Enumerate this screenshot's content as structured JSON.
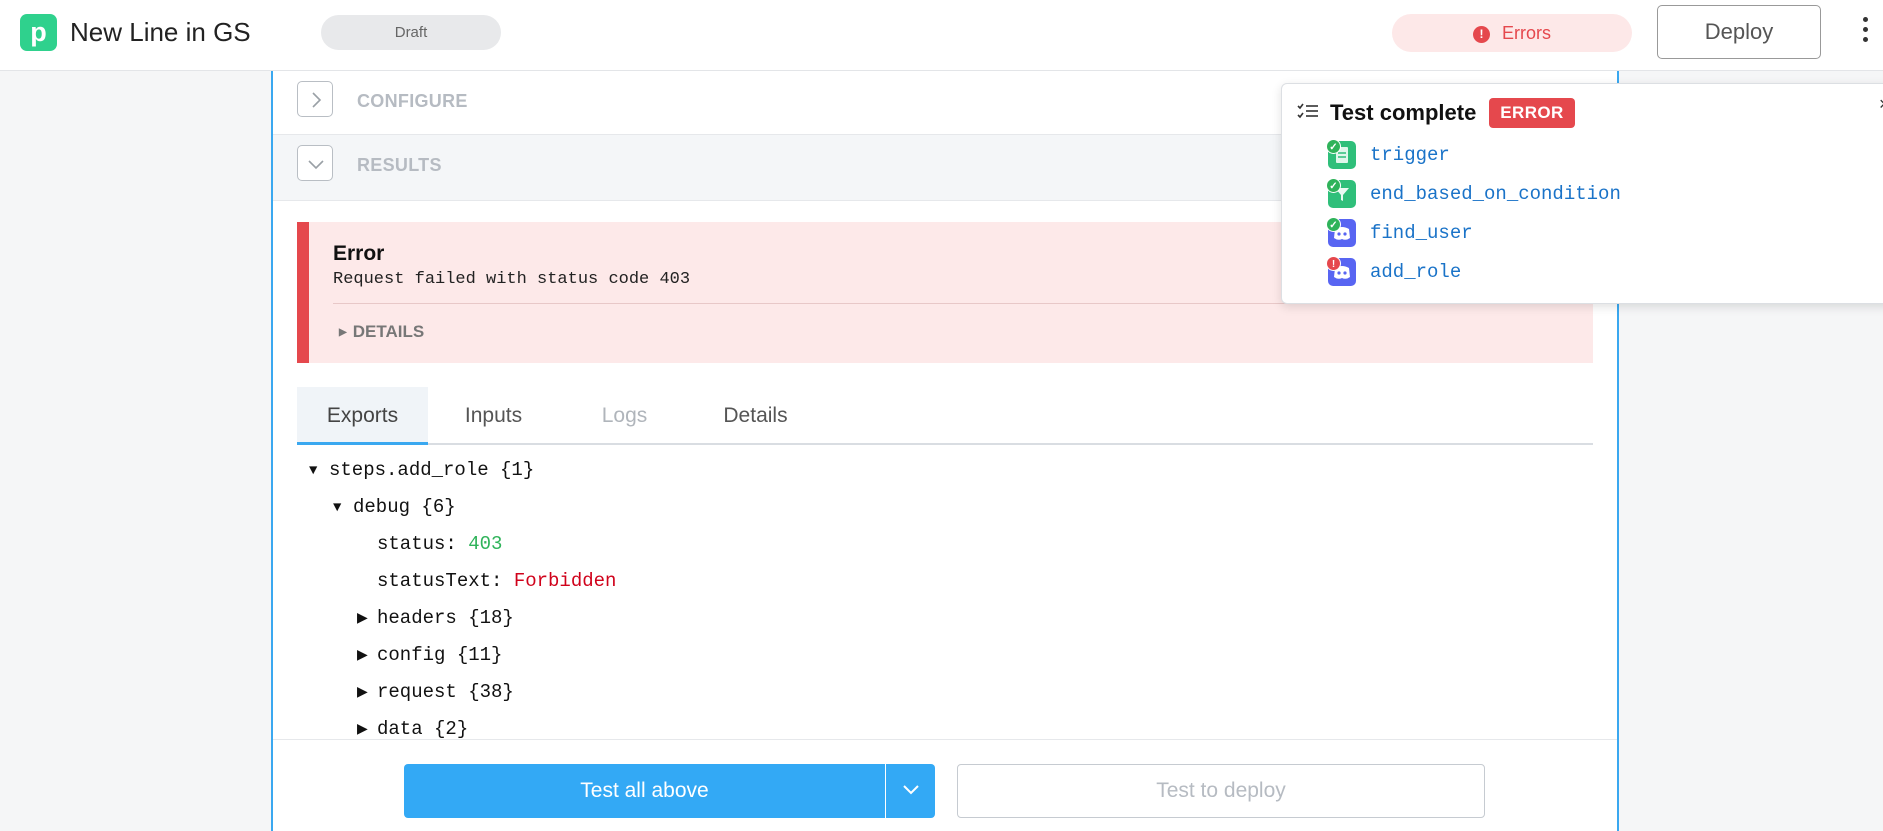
{
  "header": {
    "logo_letter": "p",
    "title": "New Line in GS",
    "status_pill": "Draft",
    "errors_label": "Errors",
    "errors_icon": "!",
    "deploy_label": "Deploy"
  },
  "panel": {
    "configure_label": "CONFIGURE",
    "results_label": "RESULTS",
    "error": {
      "title": "Error",
      "message": "Request failed with status code 403",
      "details_label": "DETAILS"
    },
    "tabs": [
      {
        "label": "Exports",
        "state": "active"
      },
      {
        "label": "Inputs",
        "state": "normal"
      },
      {
        "label": "Logs",
        "state": "disabled"
      },
      {
        "label": "Details",
        "state": "normal"
      }
    ],
    "tree": {
      "root": "steps.add_role {1}",
      "debug": "debug {6}",
      "status_key": "status: ",
      "status_value": "403",
      "status_text_key": "statusText: ",
      "status_text_value": "Forbidden",
      "headers": "headers {18}",
      "config": "config {11}",
      "request": "request {38}",
      "data": "data {2}"
    },
    "footer": {
      "test_all_label": "Test all above",
      "test_deploy_label": "Test to deploy"
    }
  },
  "popup": {
    "title": "Test complete",
    "badge": "ERROR",
    "close": "×",
    "steps": [
      {
        "label": "trigger",
        "status": "success",
        "icon": "file-icon"
      },
      {
        "label": "end_based_on_condition",
        "status": "success",
        "icon": "filter-icon"
      },
      {
        "label": "find_user",
        "status": "success",
        "icon": "discord-icon"
      },
      {
        "label": "add_role",
        "status": "error",
        "icon": "discord-icon"
      }
    ]
  },
  "colors": {
    "accent": "#33a9f5",
    "brand": "#2fd18d",
    "error": "#e5484d",
    "success": "#2fb35a"
  }
}
